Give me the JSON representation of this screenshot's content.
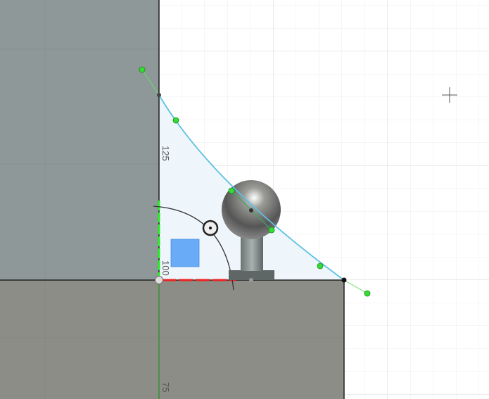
{
  "viewport": {
    "ruler_labels": [
      "125",
      "100",
      "75"
    ]
  },
  "colors": {
    "body_top": "#8f9898",
    "body_bottom": "#8d8d87",
    "spline": "#5bc0e0",
    "control_point": "#33dd33",
    "profile_fill": "#eef6fc",
    "constraint_red": "#ee2222",
    "constraint_green": "#22ee22",
    "selection_box": "#6aabf7"
  }
}
